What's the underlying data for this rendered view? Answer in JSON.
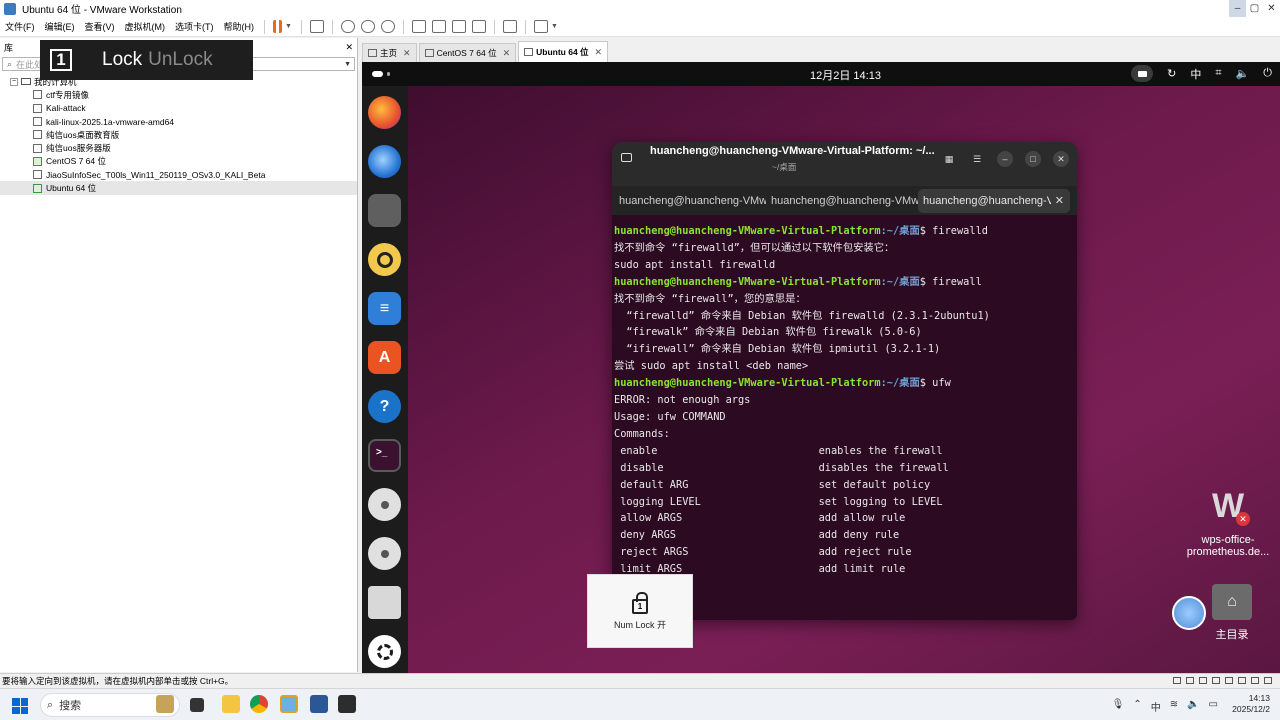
{
  "window": {
    "title": "Ubuntu 64 位 - VMware Workstation"
  },
  "menu": [
    "文件(F)",
    "编辑(E)",
    "查看(V)",
    "虚拟机(M)",
    "选项卡(T)",
    "帮助(H)"
  ],
  "library": {
    "title": "库",
    "search_placeholder": "在此处键入内容进行搜索",
    "root": "我的计算机",
    "vms": [
      "ctf专用镜像",
      "Kali-attack",
      "kali-linux-2025.1a-vmware-amd64",
      "纯信uos桌面教育版",
      "纯信uos服务器版",
      "CentOS 7 64 位",
      "JiaoSuInfoSec_T00ls_Win11_250119_OSv3.0_KALI_Beta",
      "Ubuntu 64 位"
    ]
  },
  "lock_overlay": {
    "number": "1",
    "lock": "Lock",
    "unlock": "UnLock"
  },
  "tabs": [
    {
      "label": "主页"
    },
    {
      "label": "CentOS 7 64 位"
    },
    {
      "label": "Ubuntu 64 位"
    }
  ],
  "ubuntu": {
    "clock": "12月2日  14:13",
    "ime": "中",
    "terminal": {
      "title": "huancheng@huancheng-VMware-Virtual-Platform: ~/...",
      "subtitle": "~/桌面",
      "tabs": [
        "huancheng@huancheng-VMw",
        "huancheng@huancheng-VMw",
        "huancheng@huancheng-V"
      ],
      "prompt_user": "huancheng@huancheng-VMware-Virtual-Platform",
      "prompt_path": ":~/桌面",
      "cmd1": "$ firewalld",
      "out1": [
        "找不到命令 “firewalld”，但可以通过以下软件包安装它：",
        "sudo apt install firewalld"
      ],
      "cmd2": "$ firewall",
      "out2": [
        "找不到命令 “firewall”，您的意思是：",
        "  “firewalld” 命令来自 Debian 软件包 firewalld (2.3.1-2ubuntu1)",
        "  “firewalk” 命令来自 Debian 软件包 firewalk (5.0-6)",
        "  “ifirewall” 命令来自 Debian 软件包 ipmiutil (3.2.1-1)",
        "尝试 sudo apt install <deb name>"
      ],
      "cmd3": "$ ufw",
      "out3": [
        "ERROR: not enough args",
        "",
        "Usage: ufw COMMAND",
        "",
        "Commands:",
        " enable                          enables the firewall",
        " disable                         disables the firewall",
        " default ARG                     set default policy",
        " logging LEVEL                   set logging to LEVEL",
        " allow ARGS                      add allow rule",
        " deny ARGS                       add deny rule",
        " reject ARGS                     add reject rule",
        " limit ARGS                      add limit rule"
      ]
    },
    "numlock": "Num Lock 开",
    "desktop": {
      "wps_line1": "wps-office-",
      "wps_line2": "prometheus.de...",
      "home": "主目录"
    }
  },
  "statusbar": "要将输入定向到该虚拟机，请在虚拟机内部单击或按 Ctrl+G。",
  "taskbar": {
    "search": "搜索",
    "time": "14:13",
    "date": "2025/12/2"
  }
}
